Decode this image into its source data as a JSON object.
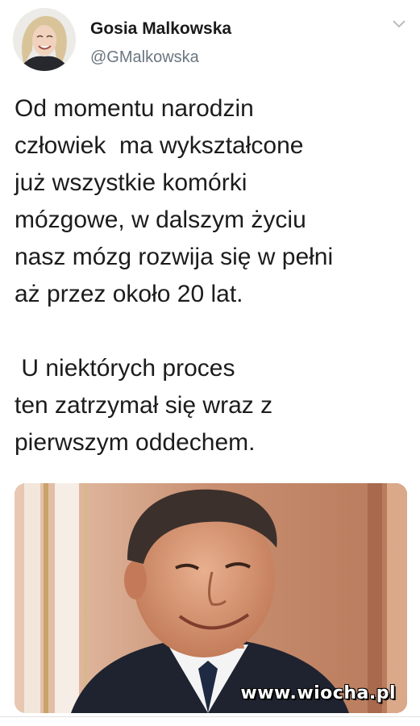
{
  "author": {
    "name": "Gosia Malkowska",
    "handle": "@GMalkowska"
  },
  "icons": {
    "menu": "chevron-down-icon"
  },
  "tweet": {
    "text": "Od momentu narodzin\nczłowiek  ma wykształcone\njuż wszystkie komórki\nmózgowe, w dalszym życiu\nnasz mózg rozwija się w pełni\naż przez około 20 lat.\n\n U niektórych proces\nten zatrzymał się wraz z\npierwszym oddechem."
  },
  "media": {
    "watermark": "www.wiocha.pl"
  },
  "colors": {
    "handle": "#6b7680",
    "text": "#1c1c1c"
  }
}
